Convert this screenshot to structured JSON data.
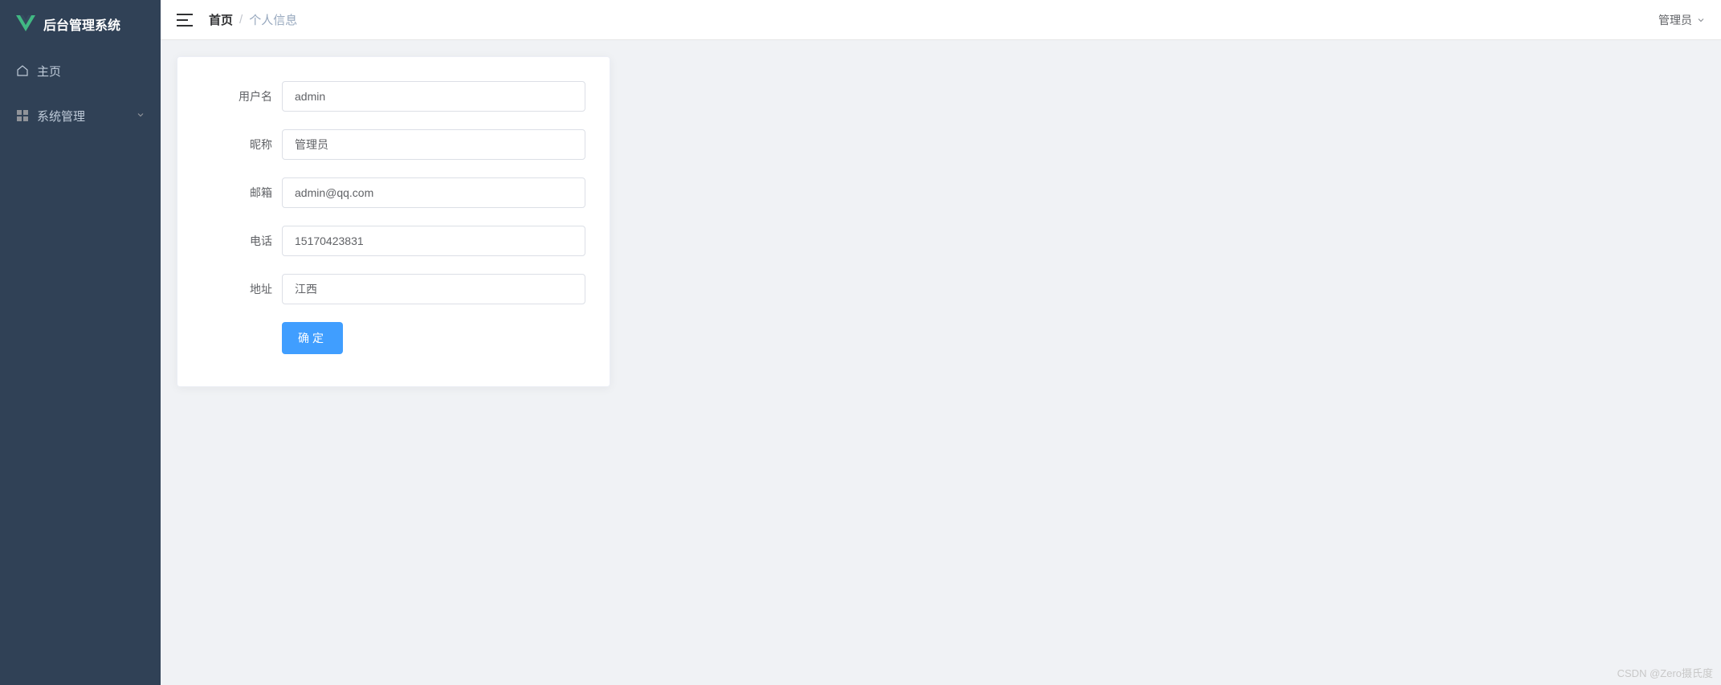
{
  "app": {
    "title": "后台管理系统"
  },
  "sidebar": {
    "items": [
      {
        "label": "主页",
        "icon": "home"
      },
      {
        "label": "系统管理",
        "icon": "grid",
        "hasChildren": true
      }
    ]
  },
  "header": {
    "breadcrumb": {
      "root": "首页",
      "current": "个人信息"
    },
    "user": "管理员"
  },
  "form": {
    "fields": [
      {
        "label": "用户名",
        "value": "admin"
      },
      {
        "label": "昵称",
        "value": "管理员"
      },
      {
        "label": "邮箱",
        "value": "admin@qq.com"
      },
      {
        "label": "电话",
        "value": "15170423831"
      },
      {
        "label": "地址",
        "value": "江西"
      }
    ],
    "submit": "确定"
  },
  "watermark": "CSDN @Zero摄氏度"
}
